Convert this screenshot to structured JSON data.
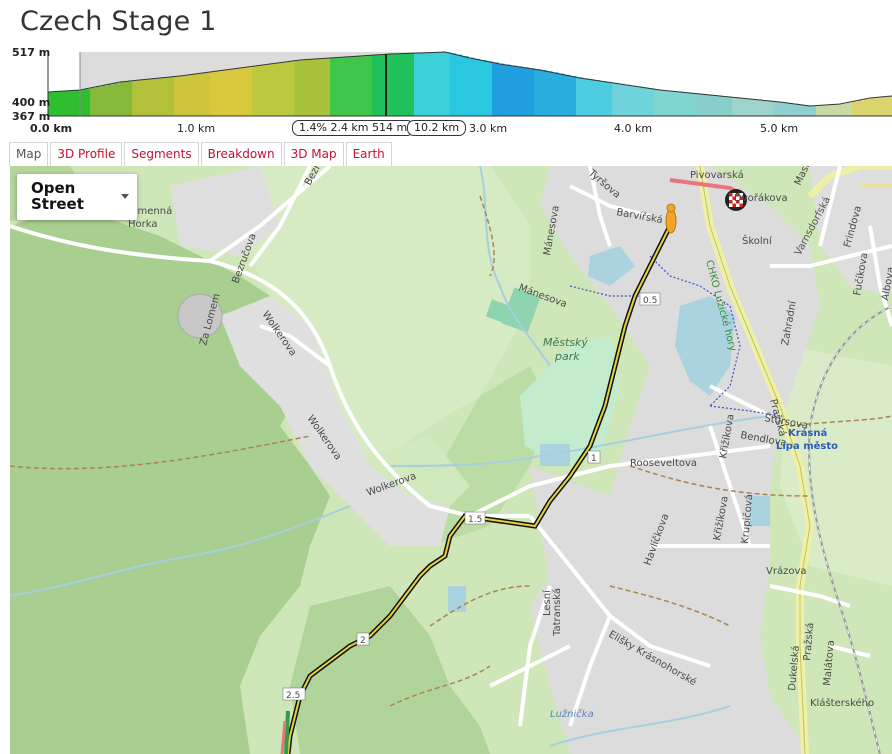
{
  "page": {
    "title": "Czech Stage 1"
  },
  "profile": {
    "y_max_label": "517 m",
    "y_mid_label": "400 m",
    "y_min_label": "367 m",
    "x_labels": [
      "0.0 km",
      "1.0 km",
      "3.0 km",
      "4.0 km",
      "5.0 km"
    ],
    "segment_info": "1.4% 2.4 km 514 m",
    "distance_info": "10.2 km"
  },
  "tabs": [
    {
      "label": "Map",
      "active": true
    },
    {
      "label": "3D Profile",
      "active": false
    },
    {
      "label": "Segments",
      "active": false
    },
    {
      "label": "Breakdown",
      "active": false
    },
    {
      "label": "3D Map",
      "active": false
    },
    {
      "label": "Earth",
      "active": false
    }
  ],
  "map": {
    "map_type": "Open Street",
    "labels": {
      "kamenna": "Kamenná",
      "horka": "Horka",
      "bezrucova": "Bezručova",
      "bezrucova2": "Bezručova",
      "wolkerova1": "Wolkerova",
      "wolkerova2": "Wolkerova",
      "wolkerova3": "Wolkerova",
      "zalomeni": "Za Lomem",
      "manesova1": "Mánesova",
      "manesova2": "Mánesova",
      "mestsky": "Městský",
      "park": "park",
      "barvirska": "Barvířská",
      "pivovarska": "Pivovarská",
      "dvorakova": "Dvořákova",
      "skolni": "Školní",
      "varnsdorfska": "Varnsdorfská",
      "chko": "CHKO Lužické hory",
      "prazska1": "Pražská",
      "prazska2": "Pražská",
      "stursova": "Štursova",
      "bendlova": "Bendlova",
      "krizikova1": "Křižíkova",
      "krizikova2": "Křižíkova",
      "rooseveltova": "Rooseveltova",
      "krasna": "Krásná",
      "lipa": "Lípa město",
      "havlickova": "Havlíčkova",
      "kruptova": "Krupičová",
      "vrazova": "Vrázova",
      "lesni": "Lesní",
      "tatranska": "Tatranská",
      "elisky": "Elišky Krásnohorské",
      "luznicka": "Lužnička",
      "dukelska": "Dukelská",
      "malatova": "Malátova",
      "klasterskeho": "Klášterského",
      "zahradni": "Zahradní",
      "frindova": "Frindova",
      "fucikova": "Fučíkova",
      "albova": "Albova",
      "tyrsova": "Tyršova",
      "masarykova": "Masary",
      "km05": "0.5",
      "km1": "1",
      "km15": "1.5",
      "km2": "2",
      "km25": "2.5"
    }
  }
}
